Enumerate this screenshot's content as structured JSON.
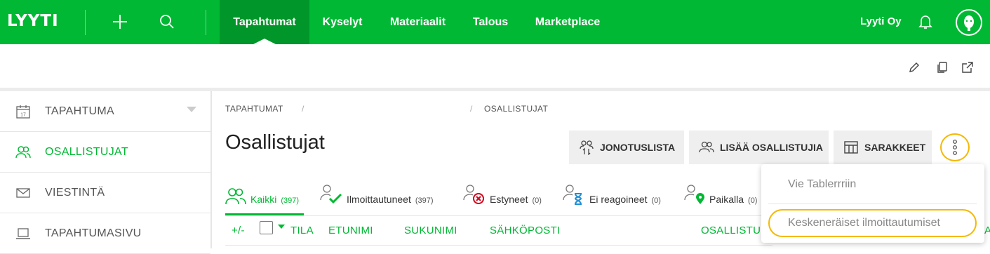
{
  "topbar": {
    "logo": "LYYTI",
    "nav": [
      "Tapahtumat",
      "Kyselyt",
      "Materiaalit",
      "Talous",
      "Marketplace"
    ],
    "company": "Lyyti Oy"
  },
  "sidebar": {
    "items": [
      {
        "label": "TAPAHTUMA",
        "icon": "calendar-icon"
      },
      {
        "label": "OSALLISTUJAT",
        "icon": "users-icon"
      },
      {
        "label": "VIESTINTÄ",
        "icon": "envelope-icon"
      },
      {
        "label": "TAPAHTUMASIVU",
        "icon": "laptop-icon"
      }
    ],
    "calendar_day": "17"
  },
  "breadcrumb": {
    "first": "TAPAHTUMAT",
    "sep": "/",
    "last": "OSALLISTUJAT"
  },
  "page": {
    "title": "Osallistujat"
  },
  "actions": {
    "waitlist": "JONOTUSLISTA",
    "add_participants": "LISÄÄ OSALLISTUJIA",
    "columns": "SARAKKEET"
  },
  "tabs": [
    {
      "label": "Kaikki",
      "count": "(397)"
    },
    {
      "label": "Ilmoittautuneet",
      "count": "(397)"
    },
    {
      "label": "Estyneet",
      "count": "(0)"
    },
    {
      "label": "Ei reagoineet",
      "count": "(0)"
    },
    {
      "label": "Paikalla",
      "count": "(0)"
    }
  ],
  "table": {
    "plusminus": "+/-",
    "headers": [
      "TILA",
      "ETUNIMI",
      "SUKUNIMI",
      "SÄHKÖPOSTI",
      "OSALLISTU"
    ],
    "edge_fragment": "A"
  },
  "dropdown": {
    "items": [
      "Vie Tablerrriin",
      "Keskeneräiset ilmoittautumiset"
    ]
  },
  "colors": {
    "brand": "#00b833",
    "brand_dark": "#009629",
    "highlight": "#f5b800"
  }
}
